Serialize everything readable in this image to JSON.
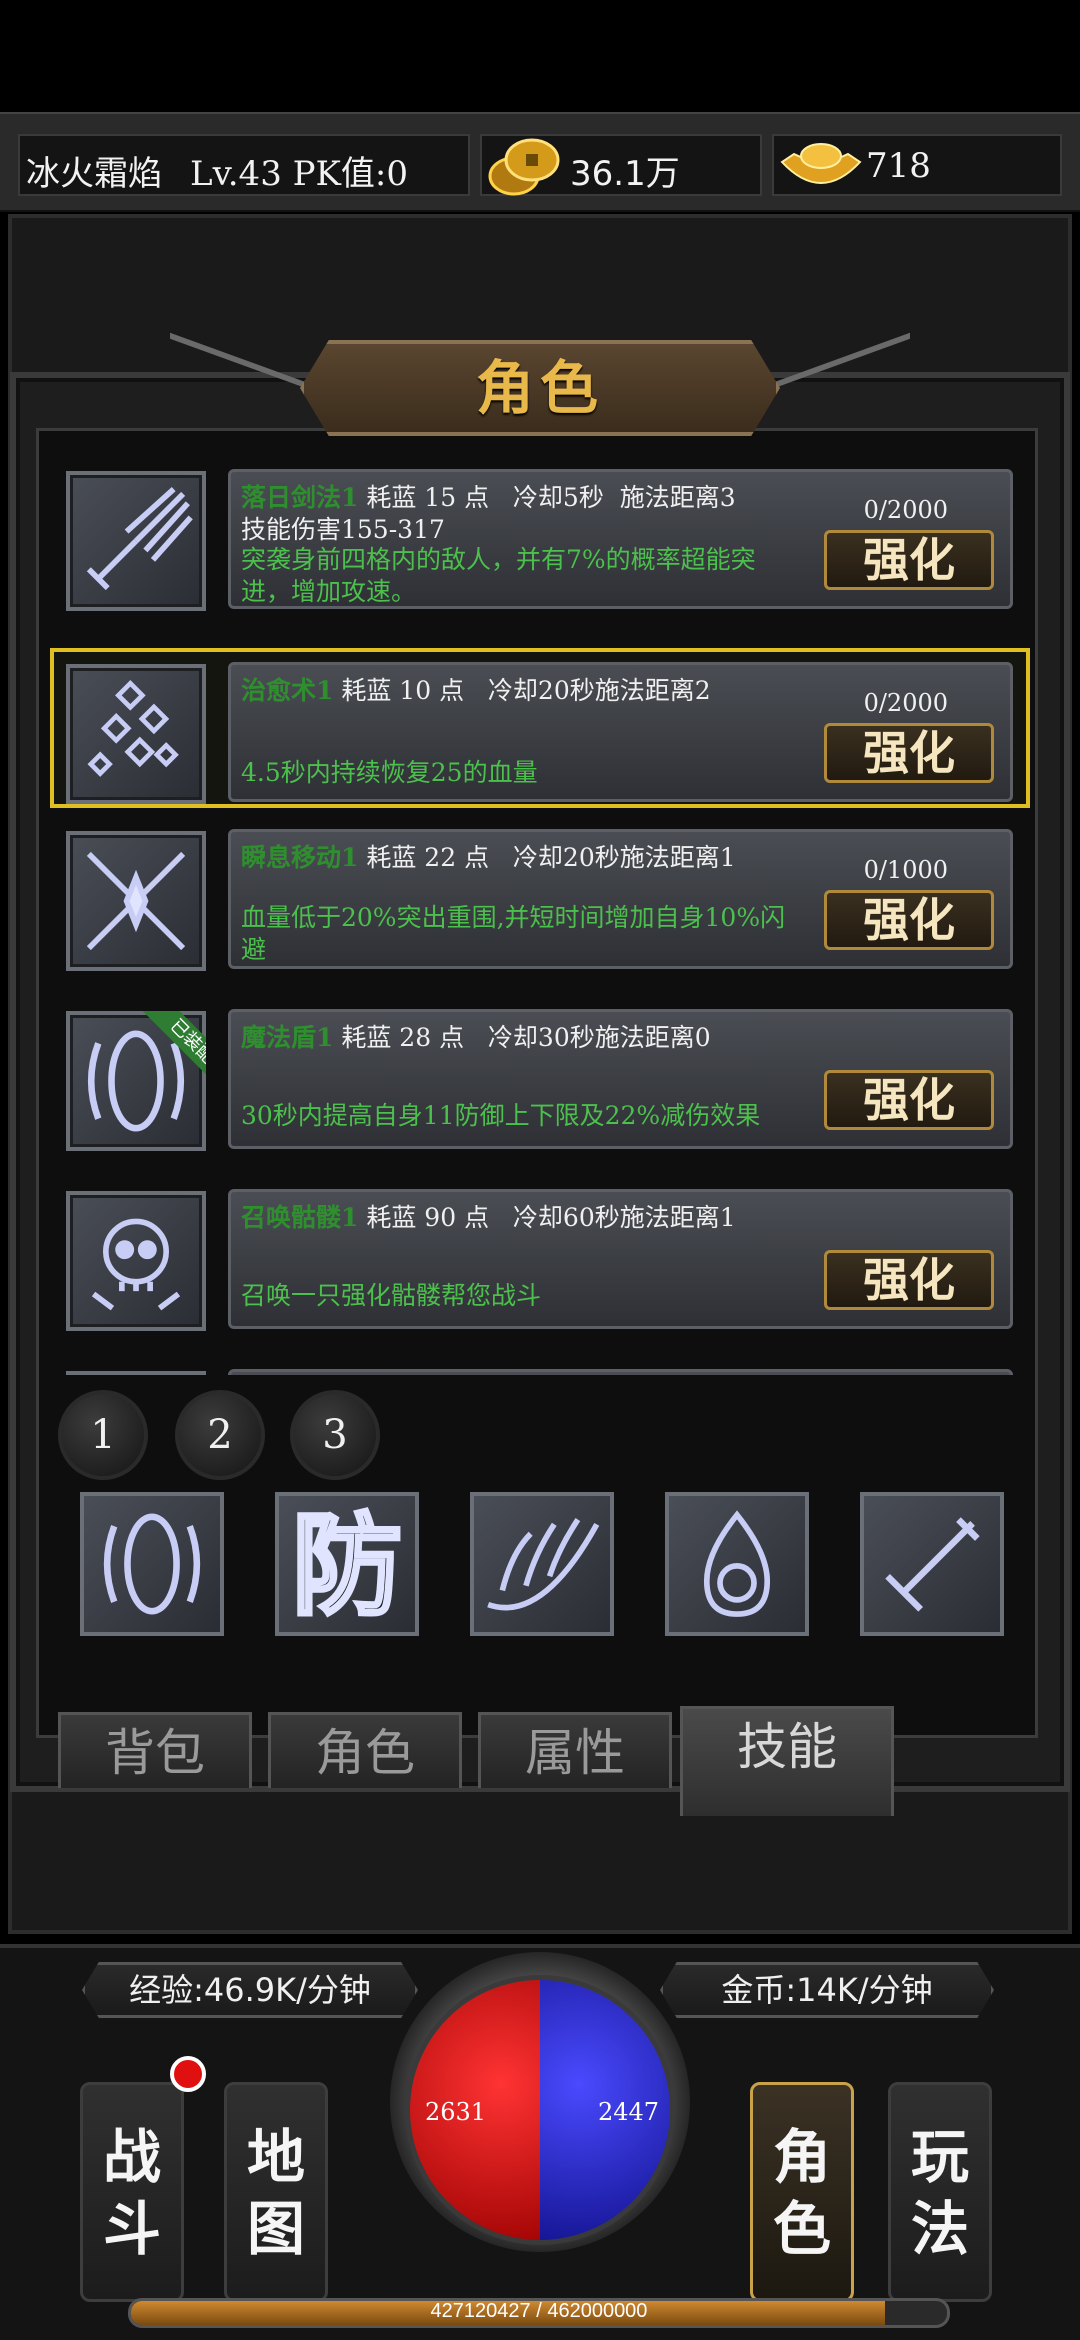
{
  "status": {
    "player_name": "冰火霜焰",
    "player_level": "Lv.43 PK值:0",
    "gold": "36.1万",
    "ingot": "718",
    "gold_icon": "gold-coins-icon",
    "ingot_icon": "gold-ingot-icon"
  },
  "panel": {
    "title": "角色"
  },
  "skills": [
    {
      "name": "落日剑法1",
      "cost": "耗蓝 15 点",
      "cooldown": "冷却5秒",
      "range": "施法距离3",
      "damage": "技能伤害155-317",
      "desc": "突袭身前四格内的敌人，并有7%的概率超能突进，增加攻速。",
      "progress": "0/2000",
      "button": "强化",
      "icon": "sword-slash-icon",
      "equipped": ""
    },
    {
      "name": "治愈术1",
      "cost": "耗蓝 10 点",
      "cooldown": "冷却20秒",
      "range": "施法距离2",
      "damage": "",
      "desc": "4.5秒内持续恢复25的血量",
      "progress": "0/2000",
      "button": "强化",
      "icon": "heal-diamonds-icon",
      "equipped": ""
    },
    {
      "name": "瞬息移动1",
      "cost": "耗蓝 22 点",
      "cooldown": "冷却20秒",
      "range": "施法距离1",
      "damage": "",
      "desc": "血量低于20%突出重围,并短时间增加自身10%闪避",
      "progress": "0/1000",
      "button": "强化",
      "icon": "teleport-star-icon",
      "equipped": ""
    },
    {
      "name": "魔法盾1",
      "cost": "耗蓝 28 点",
      "cooldown": "冷却30秒",
      "range": "施法距离0",
      "damage": "",
      "desc": "30秒内提高自身11防御上下限及22%减伤效果",
      "progress": "",
      "button": "强化",
      "icon": "magic-shield-icon",
      "equipped": "已装配"
    },
    {
      "name": "召唤骷髅1",
      "cost": "耗蓝 90 点",
      "cooldown": "冷却60秒",
      "range": "施法距离1",
      "damage": "",
      "desc": "召唤一只强化骷髅帮您战斗",
      "progress": "",
      "button": "强化",
      "icon": "skull-icon",
      "equipped": ""
    }
  ],
  "pages": [
    "1",
    "2",
    "3"
  ],
  "slots": [
    "magic-shield-icon",
    "defense-glyph-icon",
    "fire-wave-icon",
    "flame-orb-icon",
    "sword-icon"
  ],
  "slot_text": "防",
  "tabs": [
    "背包",
    "角色",
    "属性",
    "技能"
  ],
  "hud": {
    "exp_rate": "经验:46.9K/分钟",
    "gold_rate": "金币:14K/分钟",
    "hp": "2631",
    "mp": "2447",
    "exp": "427120427 / 462000000",
    "exp_fraction": 0.9245,
    "nav_fight": "战斗",
    "nav_map": "地图",
    "nav_role": "角色",
    "nav_play": "玩法"
  },
  "colors": {
    "selected_border": "#e0c020",
    "skill_name": "#2f8f2f",
    "desc": "#4cc04c",
    "gold_title": "#e8b84a"
  }
}
